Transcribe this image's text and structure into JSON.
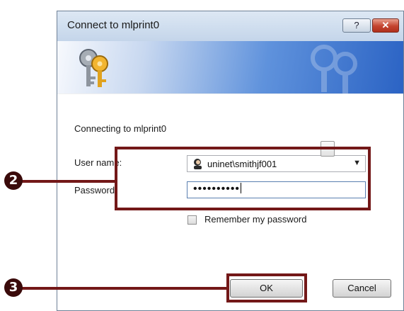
{
  "window": {
    "title": "Connect to mlprint0",
    "help_label": "?",
    "close_label": "✕"
  },
  "dialog": {
    "connecting_text": "Connecting to mlprint0",
    "username_label": "User name:",
    "username_value": "uninet\\smithjf001",
    "password_label": "Password:",
    "password_value": "••••••••••",
    "browse_label": "...",
    "remember_label": "Remember my password",
    "remember_checked": false,
    "ok_label": "OK",
    "cancel_label": "Cancel"
  },
  "annotations": {
    "step2": "2",
    "step3": "3"
  },
  "colors": {
    "annotation": "#731818",
    "banner_end": "#2b63c4"
  }
}
